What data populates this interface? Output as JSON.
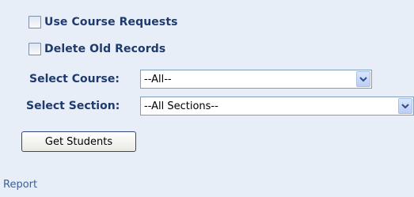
{
  "options": {
    "use_course_requests": {
      "label": "Use Course Requests",
      "checked": false
    },
    "delete_old_records": {
      "label": "Delete Old Records",
      "checked": false
    }
  },
  "course": {
    "label": "Select Course:",
    "selected": "--All--"
  },
  "section": {
    "label": "Select Section:",
    "selected": "--All Sections--"
  },
  "actions": {
    "get_students_label": "Get Students"
  },
  "footer": {
    "report_label": "Report"
  }
}
